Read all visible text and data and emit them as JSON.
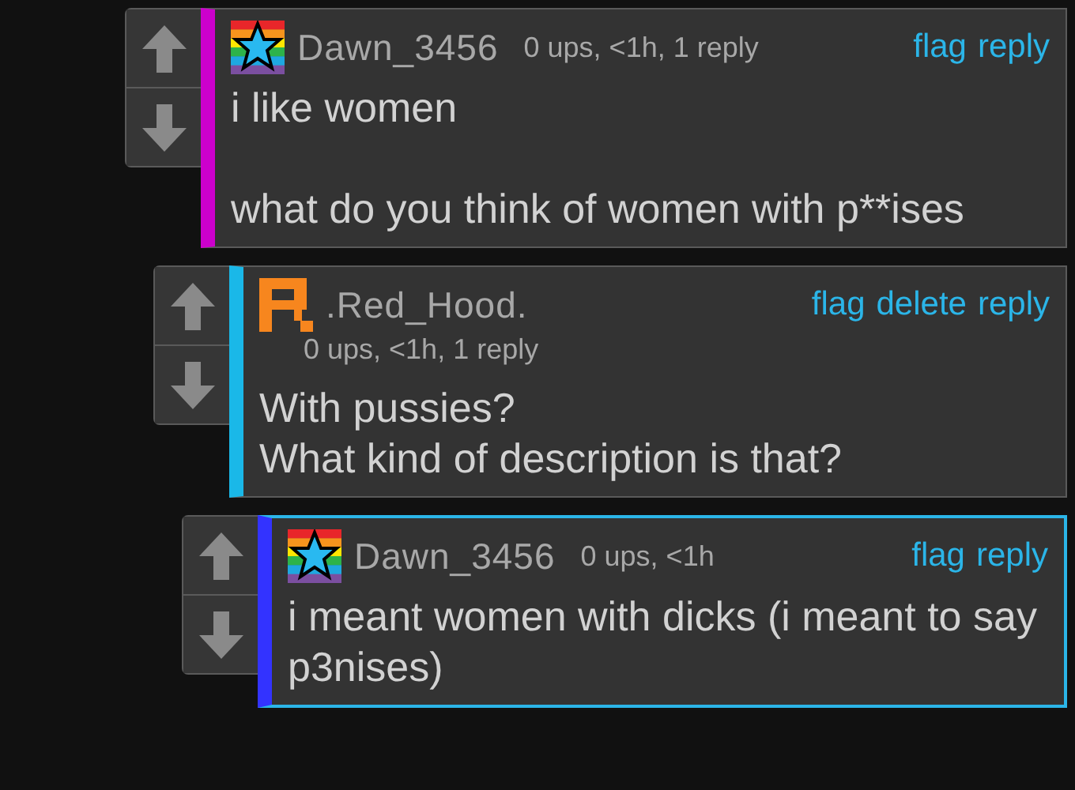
{
  "comments": [
    {
      "avatar": {
        "kind": "rainbow-star"
      },
      "username": "Dawn_3456",
      "meta": "0 ups, <1h, 1 reply",
      "meta_wrapped": false,
      "actions": [
        "flag",
        "reply"
      ],
      "color": "#cc00cc",
      "highlighted": false,
      "text": "i like women\n\nwhat do you think of women with p**ises",
      "replies": [
        {
          "avatar": {
            "kind": "pixel-r"
          },
          "username": ".Red_Hood.",
          "meta": "0 ups, <1h, 1 reply",
          "meta_wrapped": true,
          "actions": [
            "flag",
            "delete",
            "reply"
          ],
          "color": "#1ab8e8",
          "highlighted": false,
          "text": "With pussies?\nWhat kind of description is that?",
          "replies": [
            {
              "avatar": {
                "kind": "rainbow-star"
              },
              "username": "Dawn_3456",
              "meta": "0 ups, <1h",
              "meta_wrapped": false,
              "actions": [
                "flag",
                "reply"
              ],
              "color": "#3333ff",
              "highlighted": true,
              "text": "i meant women with dicks (i meant to say p3nises)"
            }
          ]
        }
      ]
    }
  ]
}
